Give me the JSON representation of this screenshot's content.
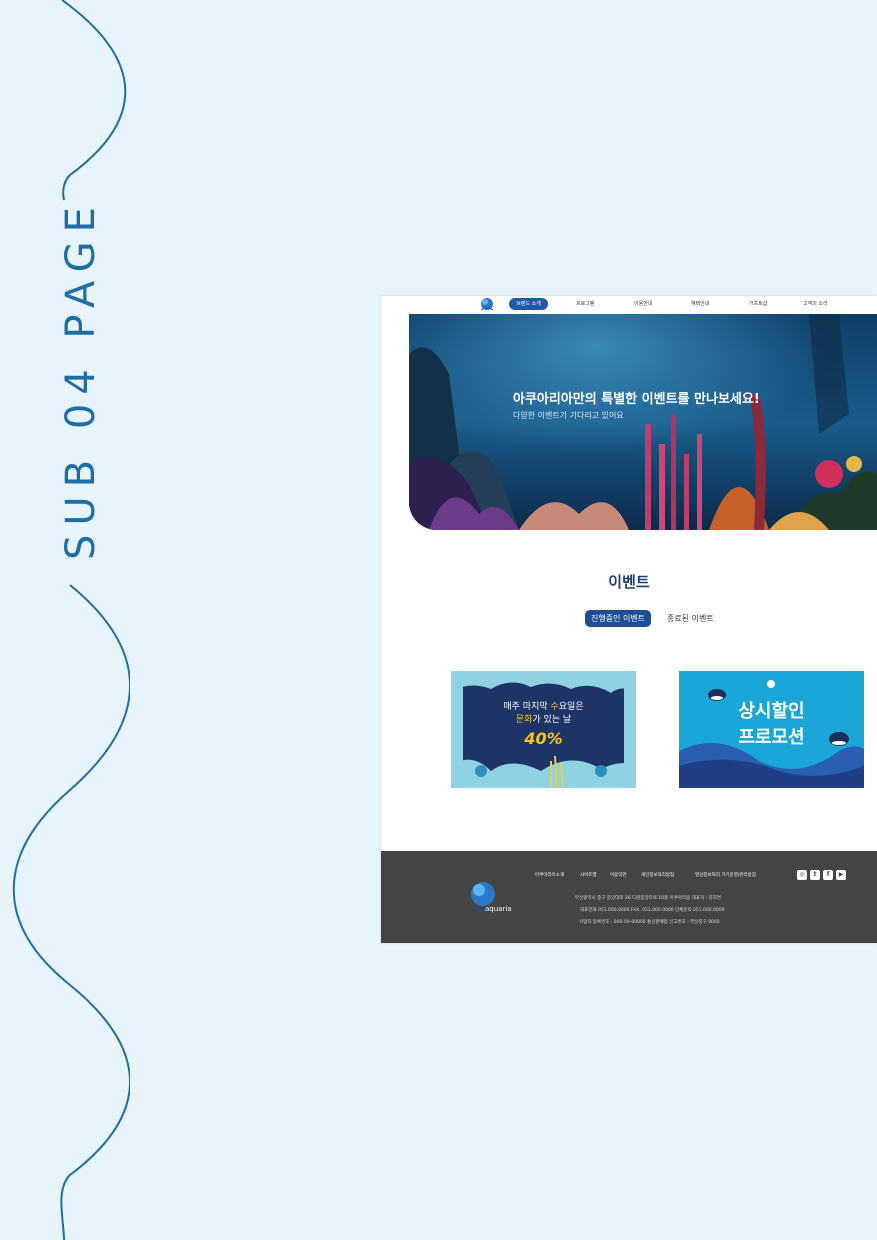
{
  "page": {
    "side_title": "SUB 04 PAGE"
  },
  "nav": {
    "items": [
      {
        "label": "브랜드 소개",
        "active": true
      },
      {
        "label": "프로그램"
      },
      {
        "label": "이용안내"
      },
      {
        "label": "혜택안내"
      },
      {
        "label": "기프트샵"
      },
      {
        "label": "고객의 소리"
      }
    ]
  },
  "hero": {
    "title": "아쿠아리아만의 특별한 이벤트를 만나보세요!",
    "subtitle": "다양한 이벤트가 기다리고 있어요"
  },
  "events": {
    "title": "이벤트",
    "tabs": [
      {
        "label": "진행중인 이벤트",
        "active": true
      },
      {
        "label": "종료된 이벤트"
      }
    ],
    "cards": [
      {
        "line1": "매주 마지막 ",
        "line1_highlight": "수",
        "line1_rest": "요일은",
        "line2_highlight": "문화",
        "line2_rest": "가 있는 날",
        "value": "40%"
      },
      {
        "line1": "상시할인",
        "line2": "프로모션"
      }
    ]
  },
  "footer": {
    "links": [
      "아쿠아리아소개",
      "사이트맵",
      "이용약관",
      "개인정보처리방침",
      "영상정보처리 기기운영/관리방침"
    ],
    "address": "부산광역시 중구 중앙대로 26 디원중앙타워 10층 아쿠아리움 대표자 : 김하연",
    "contact": "대표전화 051.000.0000   FAX. 051.000.0000   단체문의 051.000.0000",
    "business": "사업자 등록번호 : 000-00-00000 통신판매업 신고번호 : 부산중구 0000",
    "logo_text": "aquaria",
    "social": [
      "instagram-icon",
      "twitter-icon",
      "facebook-icon",
      "youtube-icon"
    ]
  },
  "colors": {
    "background": "#e7f4fb",
    "accent": "#1d6ea4",
    "nav_active": "#1e5aa8",
    "footer": "#444444"
  }
}
